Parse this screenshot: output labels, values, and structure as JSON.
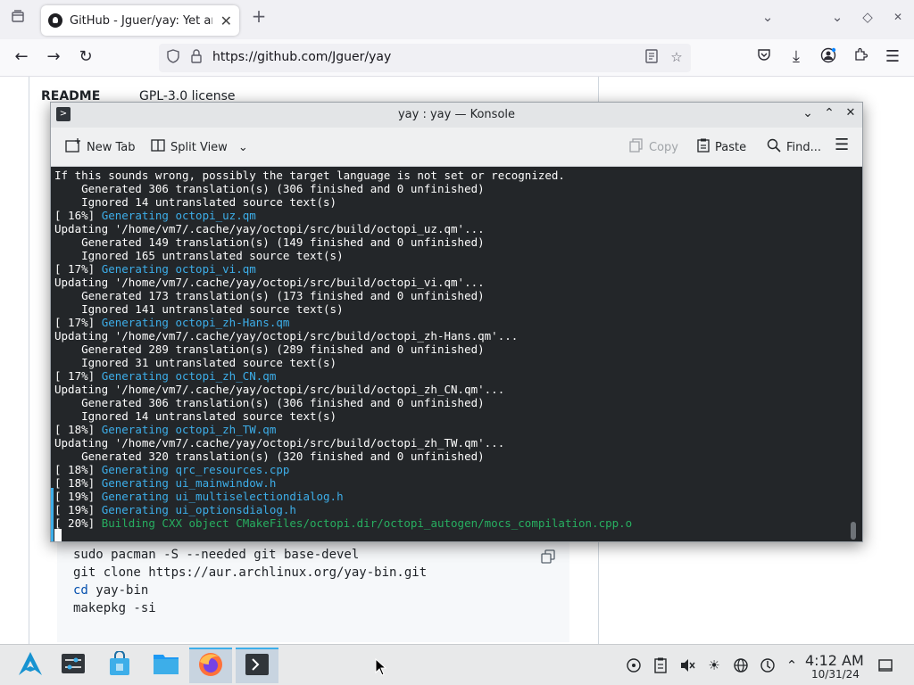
{
  "browser": {
    "tab_title": "GitHub - Jguer/yay: Yet another",
    "tab_close": "✕",
    "url": "https://github.com/Jguer/yay",
    "new_tab": "+"
  },
  "github": {
    "readme_label": "README",
    "license_label": "GPL-3.0 license",
    "code_lines": [
      "sudo pacman -S --needed git base-devel",
      "git clone https://aur.archlinux.org/yay-bin.git",
      "yay-bin",
      "makepkg -si"
    ],
    "cd_keyword": "cd"
  },
  "konsole": {
    "title": "yay : yay — Konsole",
    "toolbar": {
      "new_tab": "New Tab",
      "split_view": "Split View",
      "copy": "Copy",
      "paste": "Paste",
      "find": "Find..."
    },
    "lines": [
      {
        "prefix": "If this sounds wrong, possibly the target language is not set or recognized.",
        "colored": "",
        "color": ""
      },
      {
        "prefix": "    Generated 306 translation(s) (306 finished and 0 unfinished)",
        "colored": "",
        "color": ""
      },
      {
        "prefix": "    Ignored 14 untranslated source text(s)",
        "colored": "",
        "color": ""
      },
      {
        "prefix": "[ 16%] ",
        "colored": "Generating octopi_uz.qm",
        "color": "cyan"
      },
      {
        "prefix": "Updating '/home/vm7/.cache/yay/octopi/src/build/octopi_uz.qm'...",
        "colored": "",
        "color": ""
      },
      {
        "prefix": "    Generated 149 translation(s) (149 finished and 0 unfinished)",
        "colored": "",
        "color": ""
      },
      {
        "prefix": "    Ignored 165 untranslated source text(s)",
        "colored": "",
        "color": ""
      },
      {
        "prefix": "[ 17%] ",
        "colored": "Generating octopi_vi.qm",
        "color": "cyan"
      },
      {
        "prefix": "Updating '/home/vm7/.cache/yay/octopi/src/build/octopi_vi.qm'...",
        "colored": "",
        "color": ""
      },
      {
        "prefix": "    Generated 173 translation(s) (173 finished and 0 unfinished)",
        "colored": "",
        "color": ""
      },
      {
        "prefix": "    Ignored 141 untranslated source text(s)",
        "colored": "",
        "color": ""
      },
      {
        "prefix": "[ 17%] ",
        "colored": "Generating octopi_zh-Hans.qm",
        "color": "cyan"
      },
      {
        "prefix": "Updating '/home/vm7/.cache/yay/octopi/src/build/octopi_zh-Hans.qm'...",
        "colored": "",
        "color": ""
      },
      {
        "prefix": "    Generated 289 translation(s) (289 finished and 0 unfinished)",
        "colored": "",
        "color": ""
      },
      {
        "prefix": "    Ignored 31 untranslated source text(s)",
        "colored": "",
        "color": ""
      },
      {
        "prefix": "[ 17%] ",
        "colored": "Generating octopi_zh_CN.qm",
        "color": "cyan"
      },
      {
        "prefix": "Updating '/home/vm7/.cache/yay/octopi/src/build/octopi_zh_CN.qm'...",
        "colored": "",
        "color": ""
      },
      {
        "prefix": "    Generated 306 translation(s) (306 finished and 0 unfinished)",
        "colored": "",
        "color": ""
      },
      {
        "prefix": "    Ignored 14 untranslated source text(s)",
        "colored": "",
        "color": ""
      },
      {
        "prefix": "[ 18%] ",
        "colored": "Generating octopi_zh_TW.qm",
        "color": "cyan"
      },
      {
        "prefix": "Updating '/home/vm7/.cache/yay/octopi/src/build/octopi_zh_TW.qm'...",
        "colored": "",
        "color": ""
      },
      {
        "prefix": "    Generated 320 translation(s) (320 finished and 0 unfinished)",
        "colored": "",
        "color": ""
      },
      {
        "prefix": "[ 18%] ",
        "colored": "Generating qrc_resources.cpp",
        "color": "cyan"
      },
      {
        "prefix": "[ 18%] ",
        "colored": "Generating ui_mainwindow.h",
        "color": "cyan"
      },
      {
        "prefix": "[ 19%] ",
        "colored": "Generating ui_multiselectiondialog.h",
        "color": "cyan"
      },
      {
        "prefix": "[ 19%] ",
        "colored": "Generating ui_optionsdialog.h",
        "color": "cyan"
      },
      {
        "prefix": "[ 20%] ",
        "colored": "Building CXX object CMakeFiles/octopi.dir/octopi_autogen/mocs_compilation.cpp.o",
        "color": "green"
      }
    ]
  },
  "taskbar": {
    "time": "4:12 AM",
    "date": "10/31/24"
  },
  "colors": {
    "terminal_bg": "#232629",
    "cyan": "#3daee9",
    "green": "#27ae60",
    "accent": "#3daee9"
  }
}
